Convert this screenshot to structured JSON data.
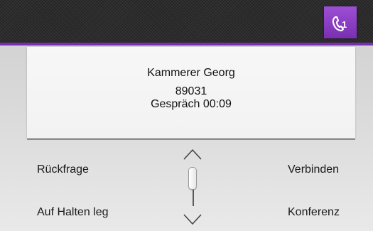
{
  "call": {
    "name": "Kammerer Georg",
    "number": "89031",
    "status": "Gespräch 00:09"
  },
  "actions": {
    "rueckfrage": "Rückfrage",
    "verbinden": "Verbinden",
    "halten": "Auf Halten leg",
    "konferenz": "Konferenz"
  },
  "icons": {
    "phone": "phone-handset-icon",
    "up": "chevron-up-icon",
    "down": "chevron-down-icon"
  },
  "colors": {
    "accent": "#7a2fb2",
    "accent_light": "#9c4fd4",
    "topbar": "#2c2c2c"
  }
}
